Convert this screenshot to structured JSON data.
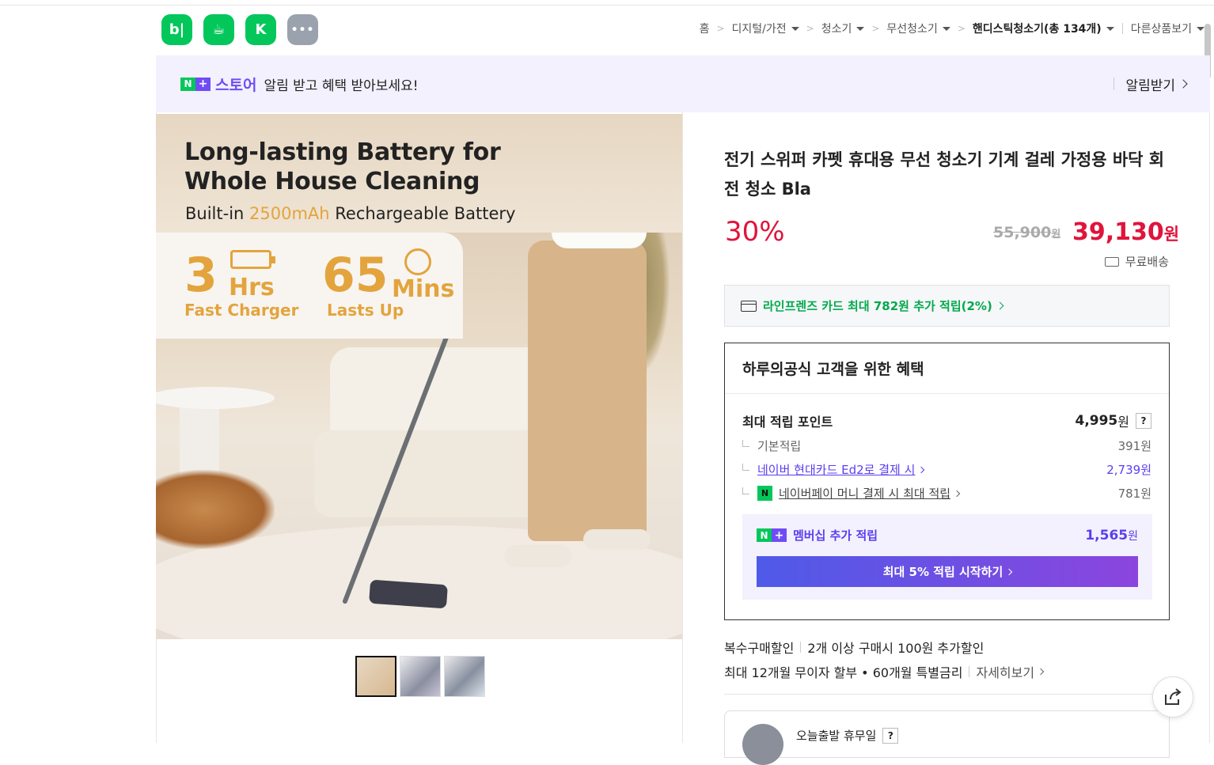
{
  "header": {
    "app_icons": [
      {
        "name": "blog-icon",
        "glyph": "b|"
      },
      {
        "name": "cafe-icon",
        "glyph": "☕"
      },
      {
        "name": "kin-icon",
        "glyph": "K"
      },
      {
        "name": "more-icon",
        "glyph": "•••"
      }
    ],
    "breadcrumb": {
      "home": "홈",
      "c1": "디지털/가전",
      "c2": "청소기",
      "c3": "무선청소기",
      "c4": "핸디스틱청소기(총 134개)",
      "other": "다른상품보기"
    }
  },
  "banner": {
    "n_badge": "N",
    "plus_badge": "+",
    "store_word": "스토어",
    "message": "알림 받고 혜택 받아보세요!",
    "action": "알림받기"
  },
  "hero": {
    "title_line1": "Long-lasting Battery for",
    "title_line2": "Whole House Cleaning",
    "sub_prefix": "Built-in ",
    "sub_accent": "2500mAh",
    "sub_suffix": " Rechargeable Battery",
    "stat1_num": "3",
    "stat1_unit": "Hrs",
    "stat1_caption": "Fast Charger",
    "stat2_num": "65",
    "stat2_unit": "Mins",
    "stat2_caption": "Lasts Up"
  },
  "product": {
    "title": "전기 스위퍼 카펫 휴대용 무선 청소기 기계 걸레 가정용 바닥 회전 청소 Bla",
    "discount": "30%",
    "original_price": "55,900",
    "original_unit": "원",
    "price": "39,130",
    "price_unit": "원",
    "shipping": "무료배송"
  },
  "card_promo": "라인프렌즈 카드 최대 782원 추가 적립(2%)",
  "benefit": {
    "heading": "하루의공식 고객을 위한 혜택",
    "max_points_label": "최대 적립 포인트",
    "max_points_value": "4,995",
    "max_points_unit": "원",
    "q_mark": "?",
    "basic_label": "기본적립",
    "basic_value": "391원",
    "hyundai_label": "네이버 현대카드 Ed2로 결제 시",
    "hyundai_value": "2,739원",
    "npay_label": "네이버페이 머니 결제 시 최대 적립",
    "npay_icon": "N",
    "npay_value": "781원",
    "member_label": "멤버십 추가 적립",
    "member_value": "1,565",
    "member_unit": "원",
    "member_cta": "최대 5% 적립 시작하기"
  },
  "extra": {
    "multi_label": "복수구매할인",
    "multi_value": "2개 이상 구매시 100원 추가할인",
    "install_text": "최대 12개월 무이자 할부 • 60개월 특별금리",
    "install_more": "자세히보기"
  },
  "bottom": {
    "today_label": "오늘출발 휴무일",
    "q_mark": "?"
  },
  "colors": {
    "naver_green": "#03c75a",
    "plus_purple": "#6f4cf6",
    "price_red": "#e0143c",
    "accent_gold": "#e3a43d"
  }
}
